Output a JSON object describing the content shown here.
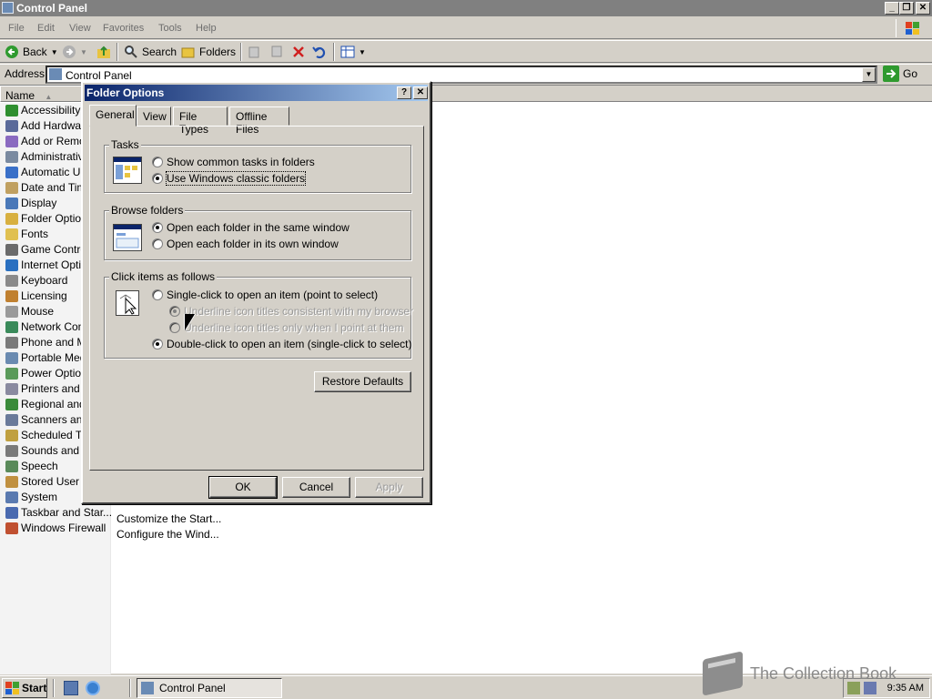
{
  "window": {
    "title": "Control Panel"
  },
  "menu": [
    "File",
    "Edit",
    "View",
    "Favorites",
    "Tools",
    "Help"
  ],
  "toolbar": {
    "back": "Back",
    "search": "Search",
    "folders": "Folders"
  },
  "address": {
    "label": "Address",
    "value": "Control Panel",
    "go": "Go"
  },
  "list": {
    "column_name": "Name",
    "items": [
      {
        "name": "Accessibility O",
        "color": "#2f8f2f"
      },
      {
        "name": "Add Hardware",
        "color": "#5a6a9a"
      },
      {
        "name": "Add or Remov",
        "color": "#8a6ac0"
      },
      {
        "name": "Administrative",
        "color": "#7a8aa0"
      },
      {
        "name": "Automatic Up",
        "color": "#3a70c8"
      },
      {
        "name": "Date and Tim",
        "color": "#c0a060"
      },
      {
        "name": "Display",
        "color": "#4a78b8"
      },
      {
        "name": "Folder Option",
        "color": "#d8b040"
      },
      {
        "name": "Fonts",
        "color": "#e0c050"
      },
      {
        "name": "Game Control",
        "color": "#6a6a6a"
      },
      {
        "name": "Internet Opti",
        "color": "#2a70c0"
      },
      {
        "name": "Keyboard",
        "color": "#8a8a8a"
      },
      {
        "name": "Licensing",
        "color": "#c08030"
      },
      {
        "name": "Mouse",
        "color": "#9a9a9a"
      },
      {
        "name": "Network Conn",
        "color": "#3a8a5a"
      },
      {
        "name": "Phone and Mo",
        "color": "#7a7a7a"
      },
      {
        "name": "Portable Medi",
        "color": "#6a8ab0"
      },
      {
        "name": "Power Option",
        "color": "#5a9a5a"
      },
      {
        "name": "Printers and F",
        "color": "#8a8aa0"
      },
      {
        "name": "Regional and",
        "color": "#3a8a3a"
      },
      {
        "name": "Scanners and",
        "color": "#6a7a9a"
      },
      {
        "name": "Scheduled Ta",
        "color": "#c0a040"
      },
      {
        "name": "Sounds and A",
        "color": "#7a7a7a"
      },
      {
        "name": "Speech",
        "color": "#5a8a5a"
      },
      {
        "name": "Stored User N",
        "color": "#c09040"
      },
      {
        "name": "System",
        "color": "#5a7ab0"
      },
      {
        "name": "Taskbar and Star...",
        "color": "#4a6ab0"
      },
      {
        "name": "Windows Firewall",
        "color": "#c05030"
      }
    ],
    "descriptions": [
      {
        "text": "Customize the Start..."
      },
      {
        "text": "Configure the Wind..."
      }
    ]
  },
  "dialog": {
    "title": "Folder Options",
    "tabs": [
      "General",
      "View",
      "File Types",
      "Offline Files"
    ],
    "tasks": {
      "label": "Tasks",
      "opt1": "Show common tasks in folders",
      "opt2": "Use Windows classic folders",
      "selected": 2
    },
    "browse": {
      "label": "Browse folders",
      "opt1": "Open each folder in the same window",
      "opt2": "Open each folder in its own window",
      "selected": 1
    },
    "click": {
      "label": "Click items as follows",
      "single": "Single-click to open an item (point to select)",
      "underline1": "Underline icon titles consistent with my browser",
      "underline2": "Underline icon titles only when I point at them",
      "double": "Double-click to open an item (single-click to select)",
      "selected": "double"
    },
    "restore": "Restore Defaults",
    "ok": "OK",
    "cancel": "Cancel",
    "apply": "Apply"
  },
  "taskbar": {
    "start": "Start",
    "task": "Control Panel",
    "clock": "9:35 AM"
  },
  "watermark": "The Collection Book"
}
